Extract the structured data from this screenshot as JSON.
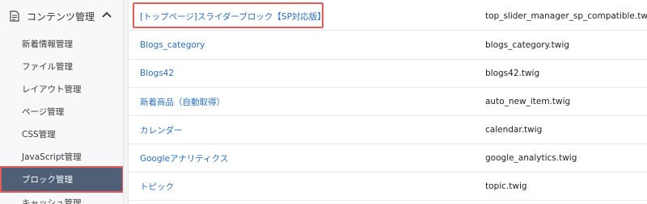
{
  "sidebar": {
    "section_title": "コンテンツ管理",
    "section_icon": "document-icon",
    "collapse_icon": "chevron-up-icon",
    "items": [
      {
        "label": "新着情報管理"
      },
      {
        "label": "ファイル管理"
      },
      {
        "label": "レイアウト管理"
      },
      {
        "label": "ページ管理"
      },
      {
        "label": "CSS管理"
      },
      {
        "label": "JavaScript管理"
      },
      {
        "label": "ブロック管理"
      },
      {
        "label": "キャッシュ管理"
      }
    ]
  },
  "blocks": {
    "rows": [
      {
        "name": "[トップページ]スライダーブロック【SP対応版】",
        "file": "top_slider_manager_sp_compatible.twig"
      },
      {
        "name": "Blogs_category",
        "file": "blogs_category.twig"
      },
      {
        "name": "Blogs42",
        "file": "blogs42.twig"
      },
      {
        "name": "新着商品（自動取得）",
        "file": "auto_new_item.twig"
      },
      {
        "name": "カレンダー",
        "file": "calendar.twig"
      },
      {
        "name": "Googleアナリティクス",
        "file": "google_analytics.twig"
      },
      {
        "name": "トピック",
        "file": "topic.twig"
      }
    ]
  },
  "colors": {
    "link": "#2a6fbb",
    "active_bg": "#4f5f76",
    "highlight": "#e25c5c"
  }
}
